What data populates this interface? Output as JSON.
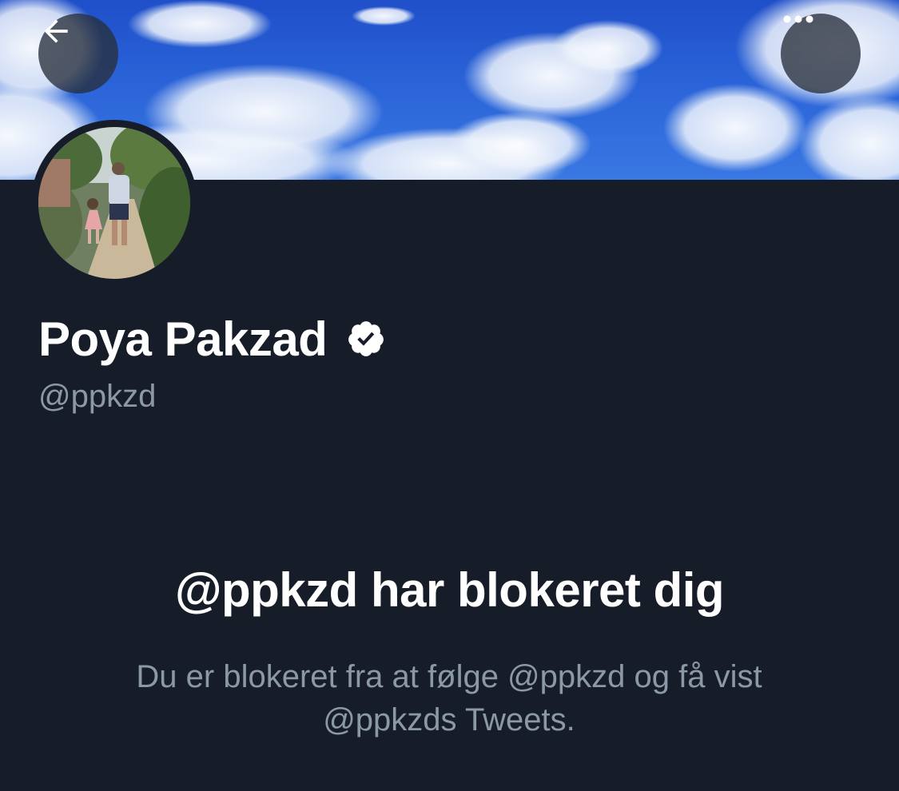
{
  "profile": {
    "display_name": "Poya Pakzad",
    "handle": "@ppkzd",
    "verified": true
  },
  "header": {
    "back_icon": "arrow-left-icon",
    "more_icon": "more-horizontal-icon"
  },
  "blocked": {
    "title": "@ppkzd har blokeret dig",
    "description": "Du er blokeret fra at følge @ppkzd og få vist @ppkzds Tweets."
  },
  "colors": {
    "background": "#161d28",
    "primary_text": "#ffffff",
    "secondary_text": "#8b98a5",
    "banner_sky": "#2a63d8"
  }
}
